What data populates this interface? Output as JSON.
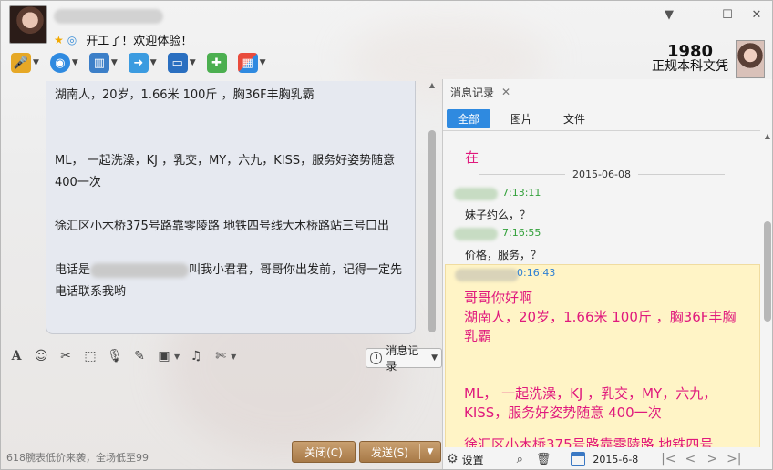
{
  "header": {
    "status_text": "开工了！欢迎体验！"
  },
  "window_controls": {
    "caret": "▼",
    "minimize": "—",
    "maximize": "☐",
    "close": "✕"
  },
  "promo": {
    "title": "1980",
    "subtitle": "正规本科文凭"
  },
  "toolbar": {
    "items": [
      {
        "icon": "microphone-icon",
        "glyph": "🎤"
      },
      {
        "icon": "webcam-icon",
        "glyph": "◉"
      },
      {
        "icon": "screen-share-icon",
        "glyph": "▥"
      },
      {
        "icon": "file-transfer-icon",
        "glyph": "➜"
      },
      {
        "icon": "remote-desktop-icon",
        "glyph": "▭"
      },
      {
        "icon": "new-chat-icon",
        "glyph": "✚"
      },
      {
        "icon": "apps-grid-icon",
        "glyph": "▦"
      }
    ]
  },
  "chat": {
    "lines": {
      "l1": "湖南人，20岁，1.66米 100斤 ，胸36F丰胸乳霸",
      "l2": "ML， 一起洗澡，KJ ，乳交，MY，六九，KISS，服务好姿势随意",
      "l3": "400一次",
      "l4": "徐汇区小木桥375号路靠零陵路 地铁四号线大木桥路站三号口出",
      "l5a": "电话是",
      "l5b": "叫我小君君，哥哥你出发前，记得一定先",
      "l6": "电话联系我哟"
    }
  },
  "input_toolbar": {
    "history_label": "消息记录"
  },
  "bottom": {
    "ad_text": "618腕表低价来袭，全场低至99",
    "close_label": "关闭(C)",
    "send_label": "发送(S)"
  },
  "history": {
    "tab_title": "消息记录",
    "filters": [
      "全部",
      "图片",
      "文件"
    ],
    "first_msg": "在",
    "date": "2015-06-08",
    "messages": [
      {
        "time": "7:13:11",
        "text": "妹子约么，？"
      },
      {
        "time": "7:16:55",
        "text": "价格，服务，？"
      }
    ],
    "highlight": {
      "time": "0:16:43",
      "line1": "哥哥你好啊",
      "line2": "湖南人，20岁，1.66米 100斤 ，胸36F丰胸乳霸",
      "line3": "ML， 一起洗澡，KJ ，乳交，MY，六九，KISS，服务好姿势随意  400一次",
      "line4": "徐汇区小木桥375号路靠零陵路 地铁四号"
    },
    "footer": {
      "settings_label": "设置",
      "date_value": "2015-6-8"
    }
  },
  "colors": {
    "accent_blue": "#2f8ae0",
    "incoming_pink": "#e0197d",
    "time_green": "#33a13b",
    "button_brown": "#a87a48",
    "highlight_yellow": "#fff4c6"
  }
}
